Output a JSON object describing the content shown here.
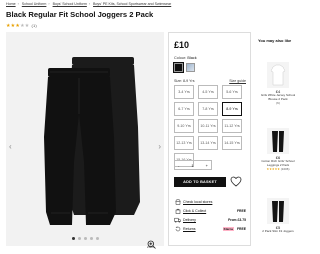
{
  "breadcrumb": [
    "Home",
    "School Uniform",
    "Boys' School Uniform",
    "Boys' PE Kits, School Sportswear and Swimwear"
  ],
  "product": {
    "title": "Black Regular Fit School Joggers 2 Pack",
    "rating_stars": 3,
    "review_count": "(1)",
    "price": "£10",
    "colour_label": "Colour:",
    "colour_value": "Black",
    "size_label": "Size: 8-9 Yrs",
    "size_guide": "Size guide",
    "sizes": [
      "3-4 Yrs",
      "4-5 Yrs",
      "5-6 Yrs",
      "6-7 Yrs",
      "7-8 Yrs",
      "8-9 Yrs",
      "9-10 Yrs",
      "10-11 Yrs",
      "11-12 Yrs",
      "12-13 Yrs",
      "13-14 Yrs",
      "14-15 Yrs",
      "15-16 Yrs"
    ],
    "selected_size": "8-9 Yrs",
    "quantity_minus": "-",
    "quantity": "1",
    "quantity_plus": "+",
    "add_button": "ADD TO BASKET",
    "zoom_label": "Zoom"
  },
  "delivery_info": [
    {
      "icon": "store-icon",
      "label": "Check local stores",
      "value": ""
    },
    {
      "icon": "click-collect-icon",
      "label": "Click & Collect",
      "value": "FREE"
    },
    {
      "icon": "delivery-truck-icon",
      "label": "Delivery",
      "value": "From £3.75"
    },
    {
      "icon": "returns-icon",
      "label": "Returns",
      "value": "FREE",
      "badge": "Klarna"
    }
  ],
  "also_like": {
    "title": "You may also like",
    "items": [
      {
        "price": "£4",
        "name": "Girls White Jersey School Blouse 2 Pack",
        "rating": "(6)"
      },
      {
        "price": "£6",
        "name": "Cotton Rich Girls' School Leggings 2 Pack",
        "rating": "(1006)"
      },
      {
        "price": "£5",
        "name": "2 Pack Slim Fit Joggers",
        "rating": ""
      }
    ]
  },
  "colors": {
    "accent": "#111111",
    "star": "#e8a000",
    "klarna": "#ffb3c7"
  }
}
